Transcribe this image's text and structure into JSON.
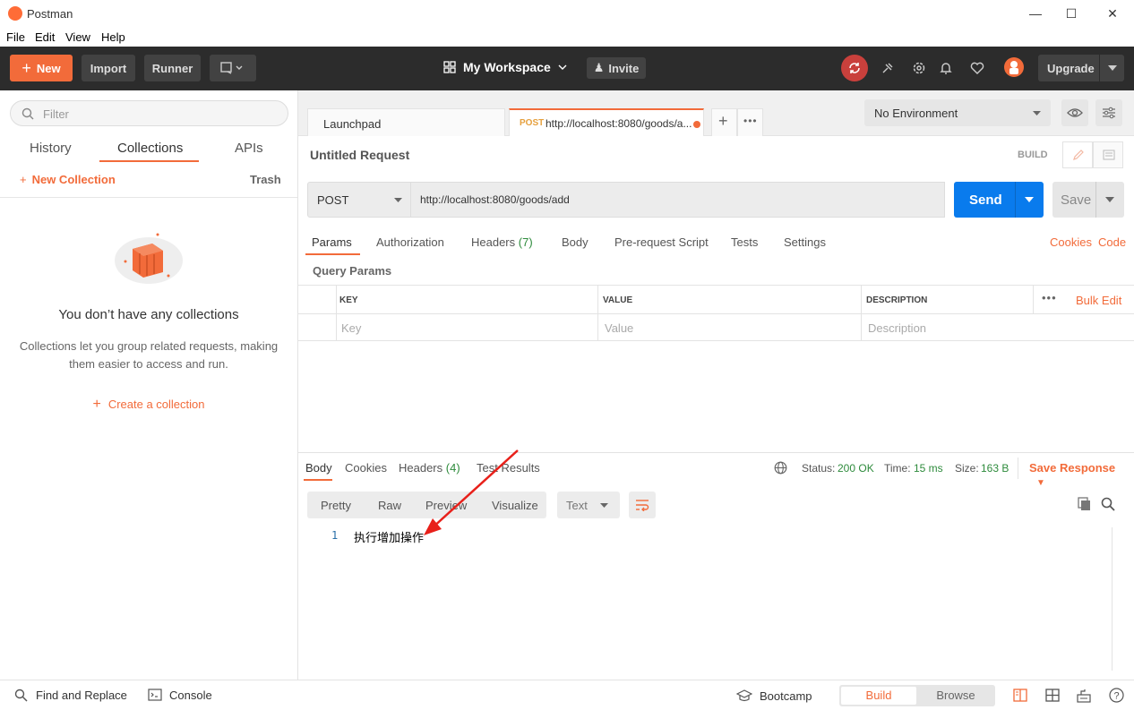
{
  "window": {
    "title": "Postman",
    "menu": [
      "File",
      "Edit",
      "View",
      "Help"
    ]
  },
  "header": {
    "new_label": "New",
    "import_label": "Import",
    "runner_label": "Runner",
    "workspace_label": "My Workspace",
    "invite_label": "Invite",
    "upgrade_label": "Upgrade",
    "accent_color": "#f26b3a"
  },
  "sidebar": {
    "filter_placeholder": "Filter",
    "tabs": [
      "History",
      "Collections",
      "APIs"
    ],
    "active_tab": "Collections",
    "new_collection_label": "New Collection",
    "trash_label": "Trash",
    "empty_title": "You don’t have any collections",
    "empty_description": "Collections let you group related requests, making them easier to access and run.",
    "create_collection_label": "Create a collection"
  },
  "request_tabs": {
    "launchpad": "Launchpad",
    "active": {
      "method": "POST",
      "url_short": "http://localhost:8080/goods/a..."
    }
  },
  "environment": {
    "selected": "No Environment"
  },
  "request": {
    "name": "Untitled Request",
    "build_label": "BUILD",
    "method": "POST",
    "url": "http://localhost:8080/goods/add",
    "send_label": "Send",
    "save_label": "Save",
    "tabs": {
      "params": "Params",
      "authorization": "Authorization",
      "headers": "Headers",
      "headers_count": "(7)",
      "body": "Body",
      "prerequest": "Pre-request Script",
      "tests": "Tests",
      "settings": "Settings"
    },
    "cookies_label": "Cookies",
    "code_label": "Code",
    "query_params_label": "Query Params",
    "table": {
      "headers": [
        "KEY",
        "VALUE",
        "DESCRIPTION"
      ],
      "placeholders": [
        "Key",
        "Value",
        "Description"
      ],
      "bulk_edit_label": "Bulk Edit"
    }
  },
  "response": {
    "tabs": {
      "body": "Body",
      "cookies": "Cookies",
      "headers": "Headers",
      "headers_count": "(4)",
      "test_results": "Test Results"
    },
    "status_label": "Status:",
    "status_value": "200 OK",
    "time_label": "Time:",
    "time_value": "15 ms",
    "size_label": "Size:",
    "size_value": "163 B",
    "save_response_label": "Save Response",
    "formats": [
      "Pretty",
      "Raw",
      "Preview",
      "Visualize"
    ],
    "type_label": "Text",
    "line_number": "1",
    "body_line": "执行增加操作"
  },
  "footer": {
    "find_replace": "Find and Replace",
    "console": "Console",
    "bootcamp": "Bootcamp",
    "build": "Build",
    "browse": "Browse"
  }
}
